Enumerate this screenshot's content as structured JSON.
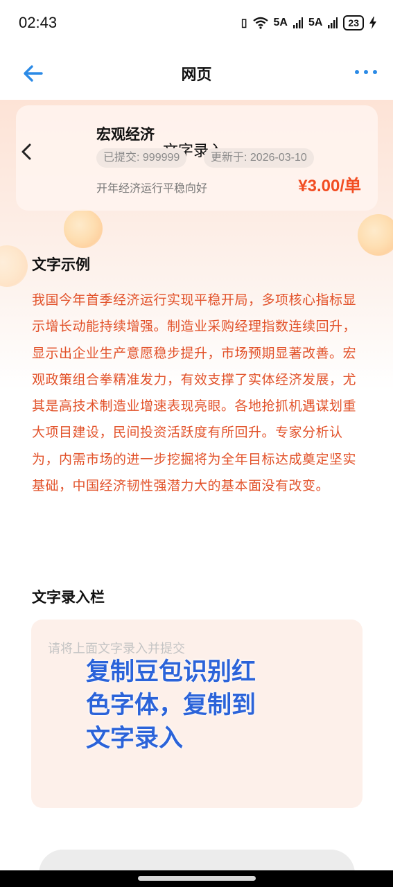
{
  "status_bar": {
    "time": "02:43",
    "network_1": "5A",
    "network_2": "5A",
    "battery": "23"
  },
  "nav": {
    "title": "网页",
    "back_icon": "arrow-left-icon",
    "more_icon": "more-dots-icon"
  },
  "task_card": {
    "title": "宏观经济",
    "overlay_title": "文字录入",
    "submitted": "已提交: 999999",
    "updated": "更新于: 2026-03-10",
    "description": "开年经济运行平稳向好",
    "price": "¥3.00/单"
  },
  "sample": {
    "title": "文字示例",
    "text": "我国今年首季经济运行实现平稳开局，多项核心指标显示增长动能持续增强。制造业采购经理指数连续回升，显示出企业生产意愿稳步提升，市场预期显著改善。宏观政策组合拳精准发力，有效支撑了实体经济发展，尤其是高技术制造业增速表现亮眼。各地抢抓机遇谋划重大项目建设，民间投资活跃度有所回升。专家分析认为，内需市场的进一步挖掘将为全年目标达成奠定坚实基础，中国经济韧性强潜力大的基本面没有改变。"
  },
  "entry": {
    "title": "文字录入栏",
    "placeholder": "请将上面文字录入并提交",
    "value": "",
    "overlay_note": "复制豆包识别红色字体，复制到文字录入"
  },
  "colors": {
    "accent_blue": "#2b8ae6",
    "price_red": "#f24d22",
    "sample_text": "#e2522a",
    "note_blue": "#2b63d9"
  }
}
